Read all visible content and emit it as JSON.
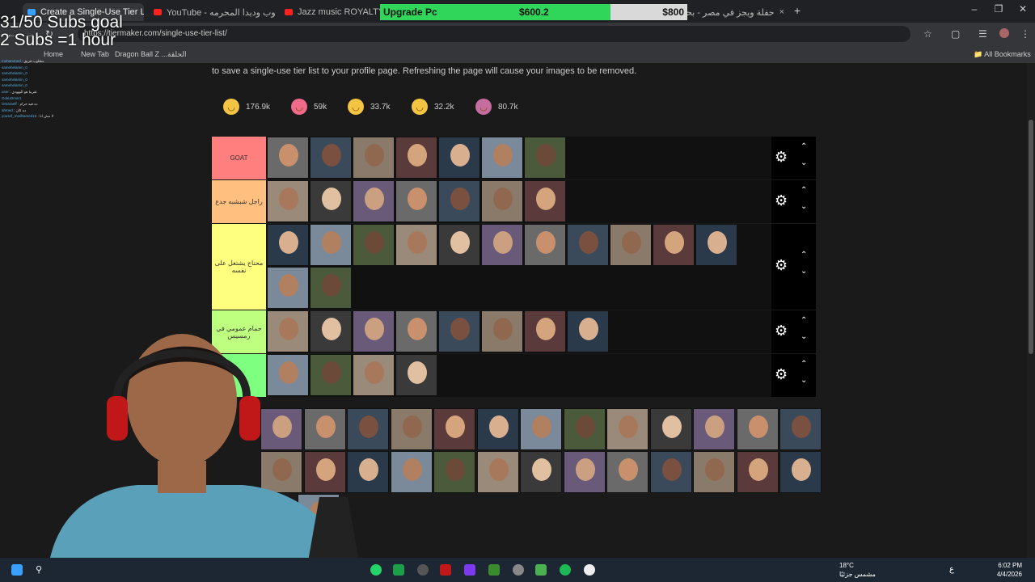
{
  "browser": {
    "tabs": [
      {
        "title": "Create a Single-Use Tier List (P...",
        "active": true,
        "favicon_color": "#3aa0ff"
      },
      {
        "title": "YouTube - ايستيوب وديدا المحرمه",
        "active": false,
        "favicon_color": "#ff2020"
      },
      {
        "title": "Jazz music ROYALTY FREE Bac",
        "active": false,
        "favicon_color": "#ff2020"
      },
      {
        "title": "حفلة ويجز في مصر - بحث Google",
        "active": false,
        "favicon_color": "#4285f4"
      }
    ],
    "close_glyph": "×",
    "new_tab_glyph": "+",
    "url": "https://tiermaker.com/single-use-tier-list/",
    "bookmarks": [
      {
        "label": "Home"
      },
      {
        "label": "New Tab"
      },
      {
        "label": "Dragon Ball Z ...الحلقة"
      }
    ],
    "all_bookmarks": "All Bookmarks"
  },
  "upgrade_bar": {
    "label": "Upgrade Pc",
    "current": "$600.2",
    "goal": "$800",
    "progress": 0.75,
    "fill_color": "#2fd65a"
  },
  "stream_overlay": {
    "subs_goal": "31/50 Subs goal",
    "subs_rule": "2 Subs =1 hour",
    "chat": [
      {
        "user": "mohammed",
        "msg": ": مطلوب فريق"
      },
      {
        "user": "samehelamin_0",
        "msg": ""
      },
      {
        "user": "samehelamin_0",
        "msg": ""
      },
      {
        "user": "samehelamin_0",
        "msg": ""
      },
      {
        "user": "samehelamin_0",
        "msg": ""
      },
      {
        "user": "user",
        "msg": ": تقريبا هو اليهودي"
      },
      {
        "user": "GokuOmar1",
        "msg": ""
      },
      {
        "user": "Omaraeff",
        "msg": ": ده فيه حرام"
      },
      {
        "user": "ahmed",
        "msg": ": ده كان"
      },
      {
        "user": "yousef_medhamed15",
        "msg": ": لا مش انا"
      }
    ]
  },
  "page": {
    "description": "to save a single-use tier list to your profile page. Refreshing the page will cause your images to be removed.",
    "reactions": [
      {
        "icon": "laugh-emoji-icon",
        "count": "176.9k",
        "color": "#f4c542"
      },
      {
        "icon": "heart-eyes-emoji-icon",
        "count": "59k",
        "color": "#f06a8a"
      },
      {
        "icon": "grin-emoji-icon",
        "count": "33.7k",
        "color": "#f4c542"
      },
      {
        "icon": "clap-emoji-icon",
        "count": "32.2k",
        "color": "#f4c542"
      },
      {
        "icon": "poop-emoji-icon",
        "count": "80.7k",
        "color": "#c66da0"
      }
    ],
    "tiers": [
      {
        "label": "GOAT",
        "color": "#ff7f7f",
        "items": 7
      },
      {
        "label": "راجل شبشبه جدع",
        "color": "#ffbf7f",
        "items": 7
      },
      {
        "label": "محتاج يشتغل على نفسه",
        "color": "#ffff7f",
        "items": 13
      },
      {
        "label": "حمام عمومي في رمسيس",
        "color": "#bfff7f",
        "items": 8
      },
      {
        "label": "",
        "color": "#7fff7f",
        "items": 4
      }
    ],
    "pool_rows": [
      13,
      13,
      1
    ],
    "icons": {
      "gear": "gear-icon",
      "up": "chevron-up-icon",
      "down": "chevron-down-icon"
    },
    "gear_glyph": "⚙",
    "up_glyph": "⌃",
    "down_glyph": "⌄"
  },
  "taskbar": {
    "weather_temp": "18°C",
    "weather_desc": "مشمس جزئيًا",
    "lang": "ع",
    "time": "6:02 PM",
    "date": "4/4/2026"
  }
}
